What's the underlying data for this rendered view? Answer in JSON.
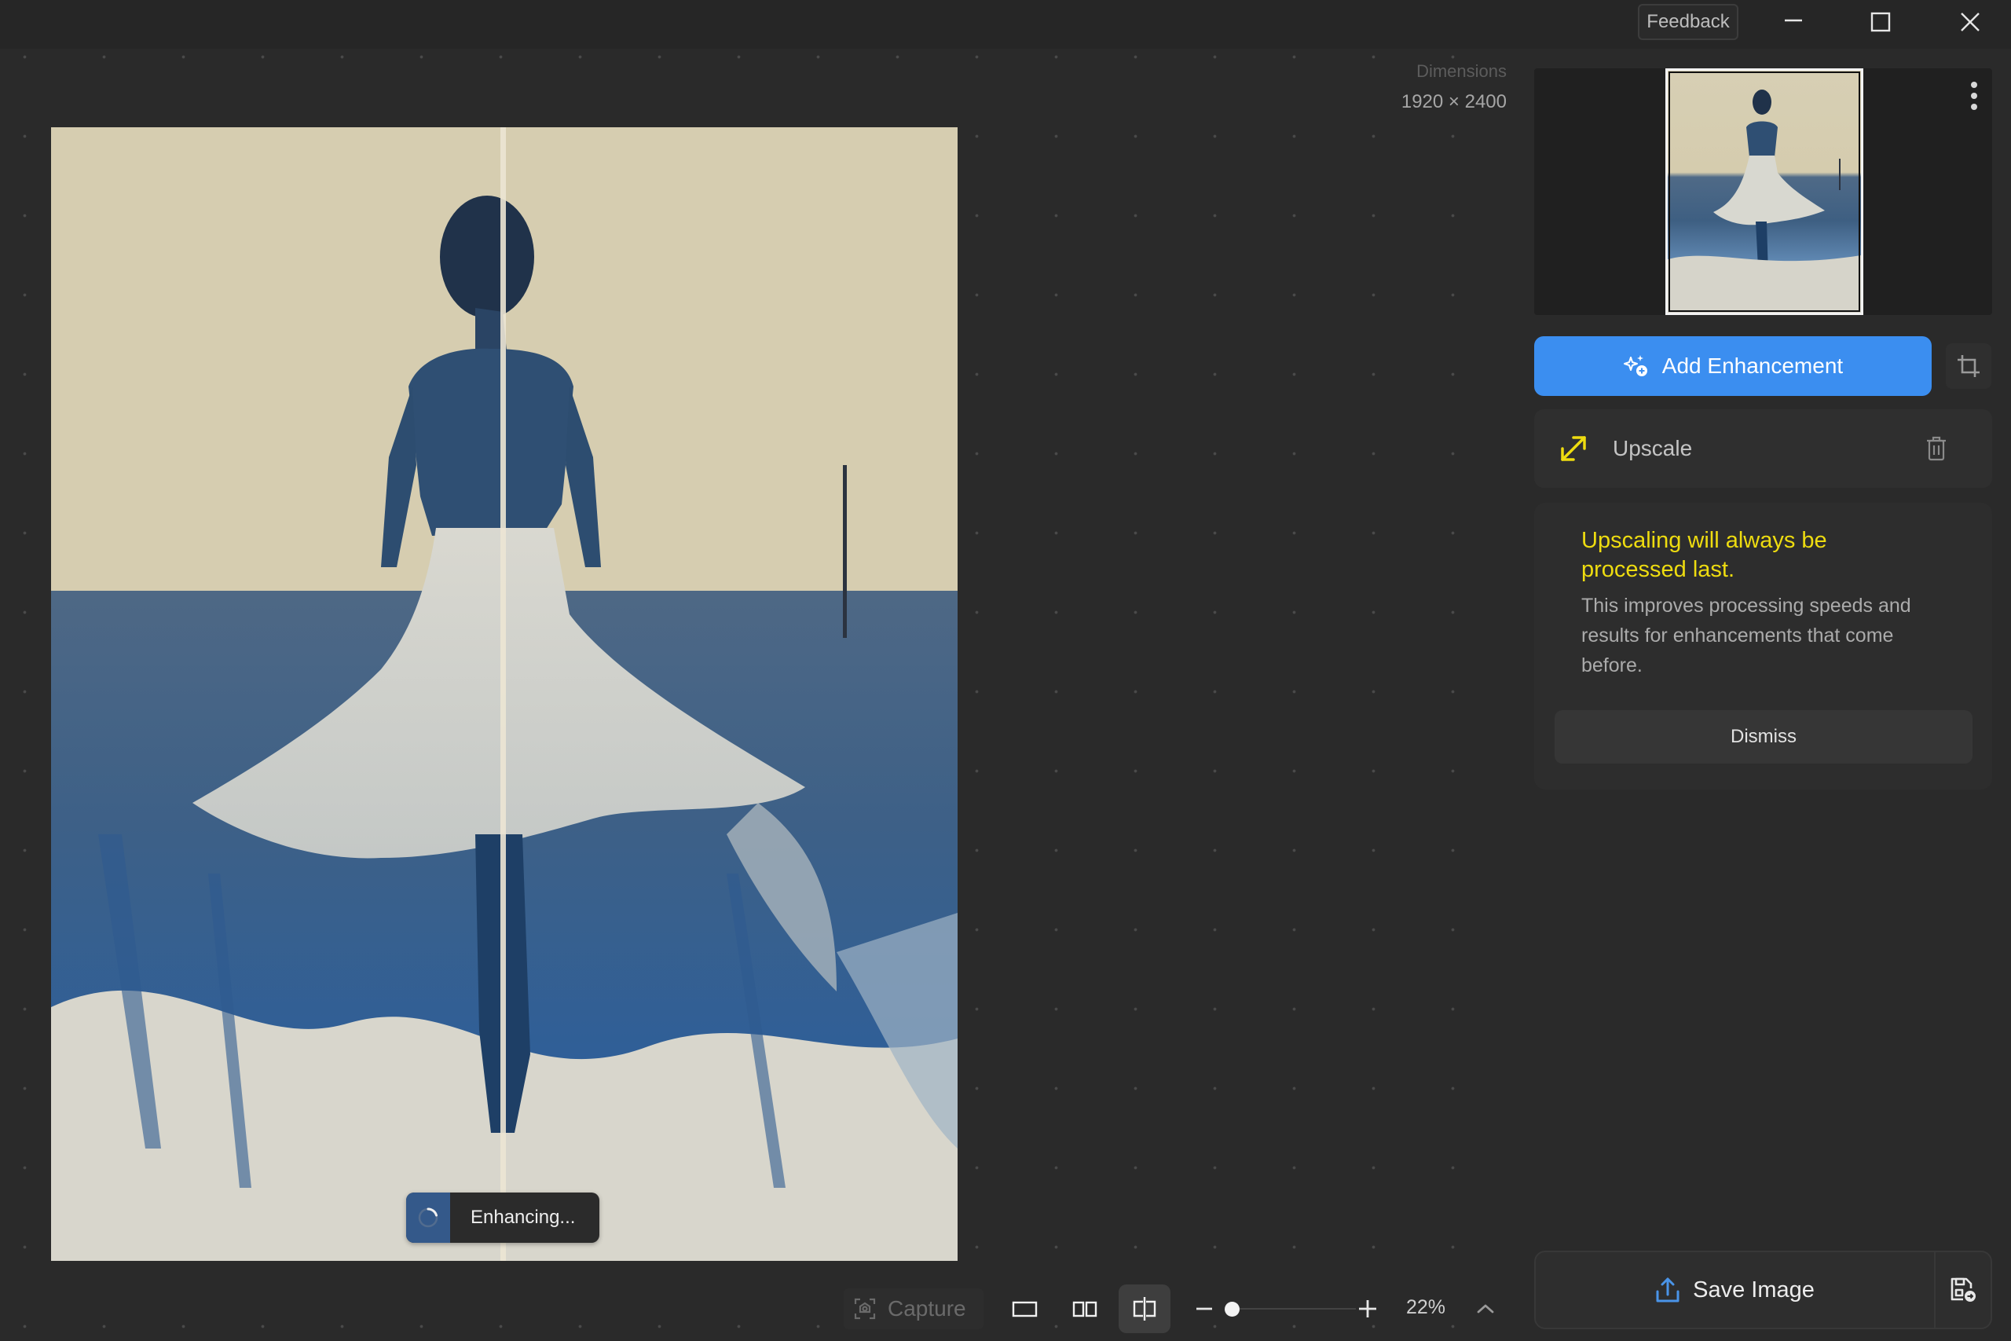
{
  "window": {
    "feedback_label": "Feedback",
    "controls": [
      "minimize",
      "maximize",
      "close"
    ]
  },
  "canvas": {
    "dimensions_label": "Dimensions",
    "dimensions_value": "1920 × 2400",
    "status_label": "Enhancing...",
    "view_mode": "split"
  },
  "sidebar": {
    "add_enhancement_label": "Add Enhancement",
    "enhancements": [
      {
        "name": "Upscale",
        "icon": "diagonal-arrows-icon",
        "icon_color": "#EEDC10"
      }
    ],
    "notice": {
      "title": "Upscaling will always be processed last.",
      "body": "This improves processing speeds and results for enhancements that come before.",
      "dismiss_label": "Dismiss"
    },
    "save_label": "Save Image"
  },
  "toolbar": {
    "capture_label": "Capture",
    "zoom_percent": "22%",
    "zoom_slider_fraction": 0.07
  },
  "colors": {
    "accent_blue": "#3B8EF0",
    "notice_yellow": "#EEDC10",
    "background": "#2A2A2A"
  }
}
